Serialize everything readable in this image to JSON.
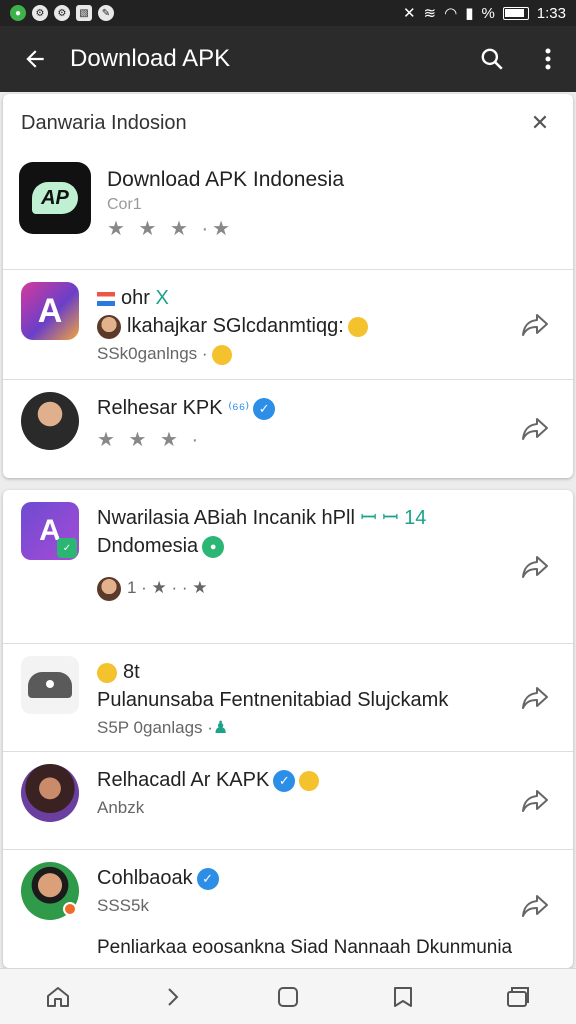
{
  "status_bar": {
    "time": "1:33",
    "notif_icons": [
      "whatsapp-icon",
      "settings-icon",
      "settings-icon",
      "gallery-icon",
      "app-icon"
    ],
    "right_icons": [
      "mute-icon",
      "vibrate-icon",
      "wifi-icon",
      "signal-icon",
      "battery-icon"
    ],
    "battery_percent": "%"
  },
  "appbar": {
    "title": "Download APK",
    "icons": [
      "back-arrow-icon",
      "search-icon",
      "more-vert-icon"
    ]
  },
  "card1": {
    "header": "Danwaria Indosion",
    "featured": {
      "title": "Download APK Indonesia",
      "sub": "Cor1",
      "stars": "★ ★ ★ ·★",
      "logo_text": "AP"
    },
    "rows": [
      {
        "line1": "ohr",
        "line1_suffix": "X",
        "line2": "lkahajkar SGlcdanmtiqg:",
        "meta": "SSk0ganlngs ·"
      },
      {
        "line1": "Relhesar KPK",
        "line1_suffix": "⁽⁶⁶⁾",
        "meta": "★ ★ ★ ·"
      }
    ]
  },
  "card2": {
    "rows": [
      {
        "line1": "Nwarilasia ABiah Incanik hPll",
        "line1_suffix": "ꟷ ꟷ 14",
        "line2": "Dndomesia",
        "meta": "1 · ★ · · ★"
      },
      {
        "line1": "8t",
        "line2": "Pulanunsaba Fentnenitabiad Slujckamk",
        "meta": "S5P 0ganlags ·"
      },
      {
        "line1": "Relhacadl Ar KAPK",
        "meta": "Anbzk"
      },
      {
        "line1": "Cohlbaoak",
        "meta": "SSS5k",
        "line3": "Penliarkaa eoosankna Siad Nannaah Dkunmunia"
      }
    ]
  },
  "navbar": {
    "icons": [
      "home-icon",
      "forward-icon",
      "square-icon",
      "book-icon",
      "tabs-icon"
    ]
  },
  "colors": {
    "appbar": "#2b2b2b",
    "verified": "#2d8ee8",
    "accent_green": "#2ea879",
    "status_bar": "#222222"
  }
}
